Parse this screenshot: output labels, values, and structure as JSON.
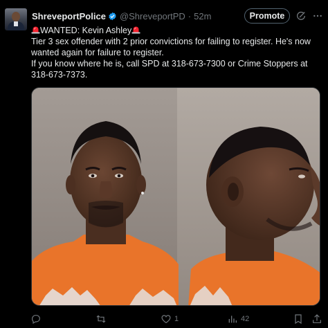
{
  "tweet": {
    "author_name": "ShreveportPolice",
    "handle": "@ShreveportPD",
    "separator": "·",
    "time": "52m",
    "promote_label": "Promote",
    "lines": [
      "WANTED: Kevin Ashley",
      "Tier 3 sex offender with 2 prior convictions for failing to register. He's now",
      "wanted again for failure to register.",
      "If you know where he is, call SPD at 318-673-7300 or Crime Stoppers at",
      "318-673-7373."
    ],
    "media_description": "mugshot-front-and-profile"
  },
  "actions": {
    "reply_count": "",
    "repost_count": "",
    "like_count": "1",
    "views_count": "42"
  },
  "colors": {
    "background": "#000000",
    "text": "#e7e9ea",
    "secondary": "#71767b",
    "verified": "#1d9bf0",
    "siren": "#f4212e"
  },
  "icons": [
    "verified-badge-icon",
    "grok-icon",
    "more-icon",
    "siren-icon",
    "reply-icon",
    "repost-icon",
    "like-icon",
    "views-icon",
    "bookmark-icon",
    "share-icon"
  ]
}
